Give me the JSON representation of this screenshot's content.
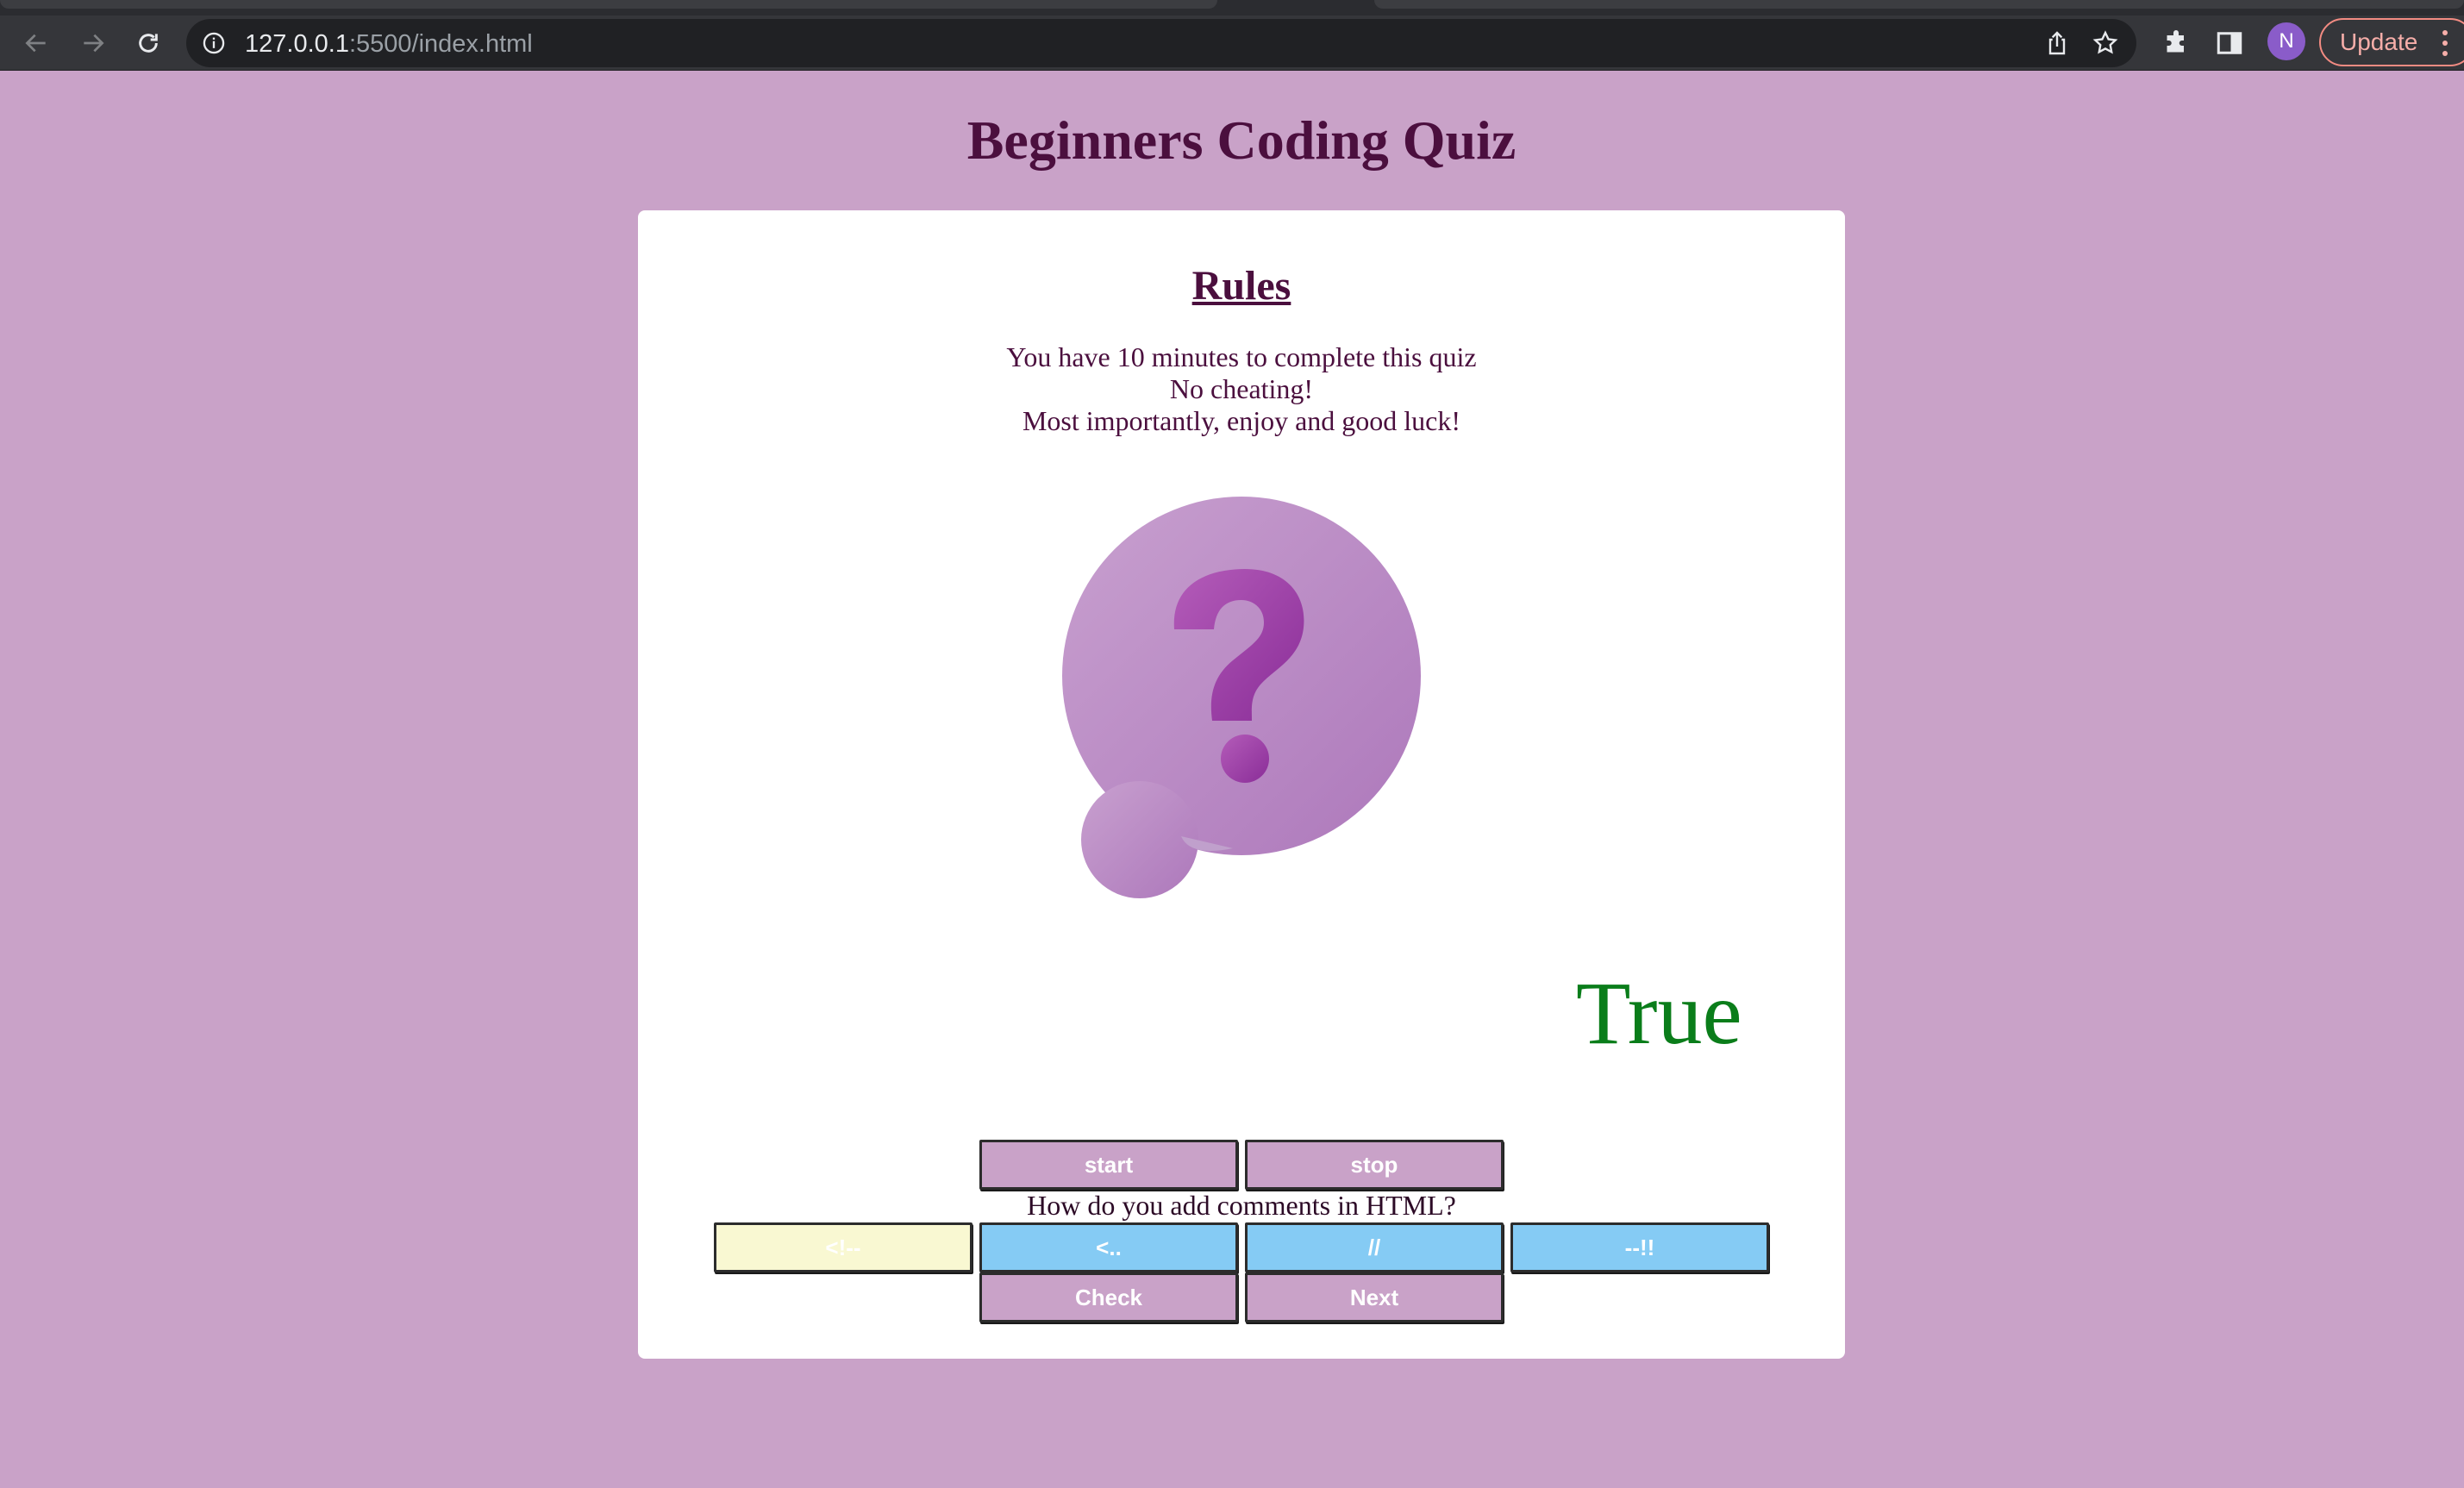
{
  "browser": {
    "url_host": "127.0.0.1",
    "url_rest": ":5500/index.html",
    "avatar_letter": "N",
    "update_label": "Update"
  },
  "page": {
    "title": "Beginners Coding Quiz"
  },
  "rules": {
    "heading": "Rules",
    "lines": [
      "You have 10 minutes to complete this quiz",
      "No cheating!",
      "Most importantly, enjoy and good luck!"
    ]
  },
  "quiz": {
    "result": "True",
    "start_label": "start",
    "stop_label": "stop",
    "question": "How do you add comments in HTML?",
    "options": [
      "<!--",
      "<..",
      "//",
      "--!!"
    ],
    "check_label": "Check",
    "next_label": "Next"
  },
  "colors": {
    "page_background": "#c9a2c8",
    "heading_text": "#4b0f3e",
    "result_text": "#0a7d1a",
    "option_blue": "#85cbf4",
    "option_selected": "#f9f8d2",
    "button_purple": "#c9a2c8"
  },
  "icons": [
    "back-arrow-icon",
    "forward-arrow-icon",
    "reload-icon",
    "info-icon",
    "share-icon",
    "star-icon",
    "extensions-icon",
    "side-panel-icon",
    "menu-dots-icon",
    "question-mark-bubble-icon"
  ]
}
